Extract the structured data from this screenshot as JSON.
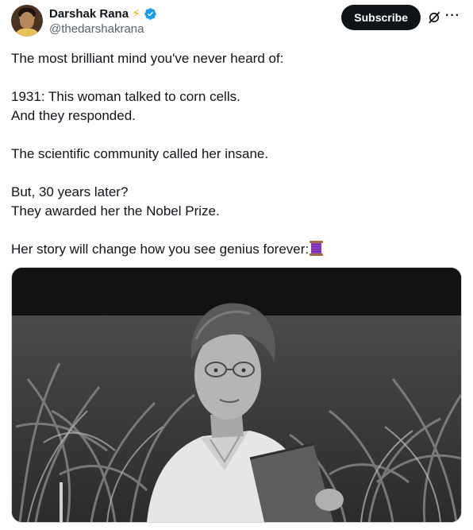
{
  "author": {
    "display_name": "Darshak Rana",
    "handle": "@thedarshakrana",
    "bolt_emoji": "⚡",
    "verified_color": "#1d9bf0"
  },
  "actions": {
    "subscribe_label": "Subscribe",
    "more_label": "···"
  },
  "tweet": {
    "lines": [
      "The most brilliant mind you've never heard of:",
      "",
      "1931: This woman talked to corn cells.",
      "And they responded.",
      "",
      "The scientific community called her insane.",
      "",
      "But, 30 years later?",
      "They awarded her the Nobel Prize.",
      "",
      "Her story will change how you see genius forever:"
    ],
    "trailing_emoji": "thread-spool-icon"
  },
  "media": {
    "type": "photo",
    "icon": "photo-woman-in-cornfield"
  },
  "colors": {
    "text": "#0f1419",
    "secondary": "#536471",
    "accent": "#1d9bf0",
    "button_bg": "#0f1419"
  }
}
